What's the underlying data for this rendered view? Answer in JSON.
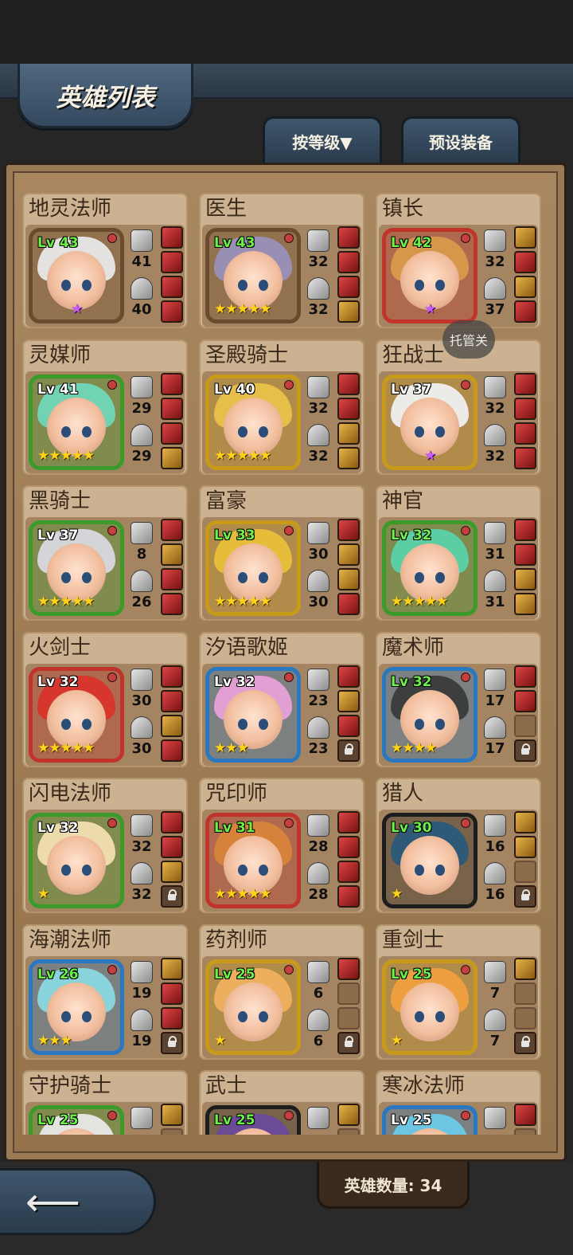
{
  "header": {
    "title": "英雄列表",
    "tabs": [
      {
        "label": "按等级▼"
      },
      {
        "label": "预设装备"
      }
    ]
  },
  "tooltip": "托管关",
  "footer": {
    "hero_count_label": "英雄数量: 34",
    "back_icon": "arrow-left-icon"
  },
  "colors": {
    "panel": "#9a7a55",
    "card": "#cdb291",
    "level_green": "#6df04a",
    "star_gold": "#ffd21a",
    "star_purple": "#c75bff"
  },
  "heroes": [
    {
      "name": "地灵法师",
      "level": "Lv 43",
      "atk": "41",
      "def": "40",
      "frame": "#6b4a2e",
      "hair": "#e8e8e8",
      "stars": "★",
      "star_type": "purple",
      "eq": [
        "red",
        "red",
        "red",
        "red"
      ],
      "lv_color": "green"
    },
    {
      "name": "医生",
      "level": "Lv 43",
      "atk": "32",
      "def": "32",
      "frame": "#6b4a2e",
      "hair": "#9a8fb8",
      "stars": "★★★★★",
      "star_type": "gold",
      "eq": [
        "red",
        "red",
        "red",
        "gold"
      ],
      "lv_color": "green"
    },
    {
      "name": "镇长",
      "level": "Lv 42",
      "atk": "32",
      "def": "37",
      "frame": "#c0342b",
      "hair": "#d89a4a",
      "stars": "★",
      "star_type": "purple",
      "eq": [
        "gold",
        "red",
        "gold",
        "red"
      ],
      "lv_color": "green"
    },
    {
      "name": "灵媒师",
      "level": "Lv 41",
      "atk": "29",
      "def": "29",
      "frame": "#3a9a2a",
      "hair": "#6fd7b8",
      "stars": "★★★★★",
      "star_type": "gold",
      "eq": [
        "red",
        "red",
        "red",
        "gold"
      ],
      "lv_color": "white"
    },
    {
      "name": "圣殿骑士",
      "level": "Lv 40",
      "atk": "32",
      "def": "32",
      "frame": "#c89a1a",
      "hair": "#e8c24a",
      "stars": "★★★★★",
      "star_type": "gold",
      "eq": [
        "red",
        "red",
        "gold",
        "gold"
      ],
      "lv_color": "white"
    },
    {
      "name": "狂战士",
      "level": "Lv 37",
      "atk": "32",
      "def": "32",
      "frame": "#c89a1a",
      "hair": "#f0f0f0",
      "stars": "★",
      "star_type": "purple",
      "eq": [
        "red",
        "red",
        "red",
        "red"
      ],
      "lv_color": "white"
    },
    {
      "name": "黑骑士",
      "level": "Lv 37",
      "atk": "8",
      "def": "26",
      "frame": "#3a9a2a",
      "hair": "#d8d8e0",
      "stars": "★★★★★",
      "star_type": "gold",
      "eq": [
        "red",
        "gold",
        "red",
        "red"
      ],
      "lv_color": "white"
    },
    {
      "name": "富豪",
      "level": "Lv 33",
      "atk": "30",
      "def": "30",
      "frame": "#c89a1a",
      "hair": "#e8c03a",
      "stars": "★★★★★",
      "star_type": "gold",
      "eq": [
        "red",
        "gold",
        "gold",
        "red"
      ],
      "lv_color": "green"
    },
    {
      "name": "神官",
      "level": "Lv 32",
      "atk": "31",
      "def": "31",
      "frame": "#3a9a2a",
      "hair": "#5ad2a8",
      "stars": "★★★★★",
      "star_type": "gold",
      "eq": [
        "red",
        "red",
        "gold",
        "gold"
      ],
      "lv_color": "green"
    },
    {
      "name": "火剑士",
      "level": "Lv 32",
      "atk": "30",
      "def": "30",
      "frame": "#c0342b",
      "hair": "#d8342a",
      "stars": "★★★★★",
      "star_type": "gold",
      "eq": [
        "red",
        "red",
        "gold",
        "red"
      ],
      "lv_color": "white"
    },
    {
      "name": "汐语歌姬",
      "level": "Lv 32",
      "atk": "23",
      "def": "23",
      "frame": "#2a78c0",
      "hair": "#e8a0d8",
      "stars": "★★★",
      "star_type": "gold",
      "eq": [
        "red",
        "gold",
        "red",
        "lock"
      ],
      "lv_color": "white"
    },
    {
      "name": "魔术师",
      "level": "Lv 32",
      "atk": "17",
      "def": "17",
      "frame": "#2a78c0",
      "hair": "#3a3a3a",
      "stars": "★★★★",
      "star_type": "gold",
      "eq": [
        "red",
        "red",
        "empty",
        "lock"
      ],
      "lv_color": "green"
    },
    {
      "name": "闪电法师",
      "level": "Lv 32",
      "atk": "32",
      "def": "32",
      "frame": "#3a9a2a",
      "hair": "#f2dfb0",
      "stars": "★",
      "star_type": "gold",
      "eq": [
        "red",
        "red",
        "gold",
        "lock"
      ],
      "lv_color": "white"
    },
    {
      "name": "咒印师",
      "level": "Lv 31",
      "atk": "28",
      "def": "28",
      "frame": "#c0342b",
      "hair": "#d8843a",
      "stars": "★★★★★",
      "star_type": "gold",
      "eq": [
        "red",
        "red",
        "red",
        "red"
      ],
      "lv_color": "green"
    },
    {
      "name": "猎人",
      "level": "Lv 30",
      "atk": "16",
      "def": "16",
      "frame": "#1d1d1d",
      "hair": "#2a5a7a",
      "stars": "★",
      "star_type": "gold",
      "eq": [
        "gold",
        "gold",
        "empty",
        "lock"
      ],
      "lv_color": "green"
    },
    {
      "name": "海潮法师",
      "level": "Lv 26",
      "atk": "19",
      "def": "19",
      "frame": "#2a78c0",
      "hair": "#8ad8e0",
      "stars": "★★★",
      "star_type": "gold",
      "eq": [
        "gold",
        "red",
        "red",
        "lock"
      ],
      "lv_color": "green"
    },
    {
      "name": "药剂师",
      "level": "Lv 25",
      "atk": "6",
      "def": "6",
      "frame": "#c89a1a",
      "hair": "#f0b060",
      "stars": "★",
      "star_type": "gold",
      "eq": [
        "red",
        "empty",
        "empty",
        "lock"
      ],
      "lv_color": "green"
    },
    {
      "name": "重剑士",
      "level": "Lv 25",
      "atk": "7",
      "def": "7",
      "frame": "#c89a1a",
      "hair": "#f0a040",
      "stars": "★",
      "star_type": "gold",
      "eq": [
        "gold",
        "empty",
        "empty",
        "lock"
      ],
      "lv_color": "green"
    },
    {
      "name": "守护骑士",
      "level": "Lv 25",
      "atk": "",
      "def": "",
      "frame": "#3a9a2a",
      "hair": "#e8e8e8",
      "stars": "",
      "star_type": "gold",
      "eq": [
        "gold",
        "empty",
        "empty",
        "lock"
      ],
      "lv_color": "green"
    },
    {
      "name": "武士",
      "level": "Lv 25",
      "atk": "",
      "def": "",
      "frame": "#1d1d1d",
      "hair": "#6a4a9a",
      "stars": "",
      "star_type": "gold",
      "eq": [
        "gold",
        "empty",
        "empty",
        "lock"
      ],
      "lv_color": "green"
    },
    {
      "name": "寒冰法师",
      "level": "Lv 25",
      "atk": "",
      "def": "",
      "frame": "#2a78c0",
      "hair": "#6ac8e8",
      "stars": "",
      "star_type": "gold",
      "eq": [
        "red",
        "empty",
        "empty",
        "lock"
      ],
      "lv_color": "white"
    }
  ]
}
